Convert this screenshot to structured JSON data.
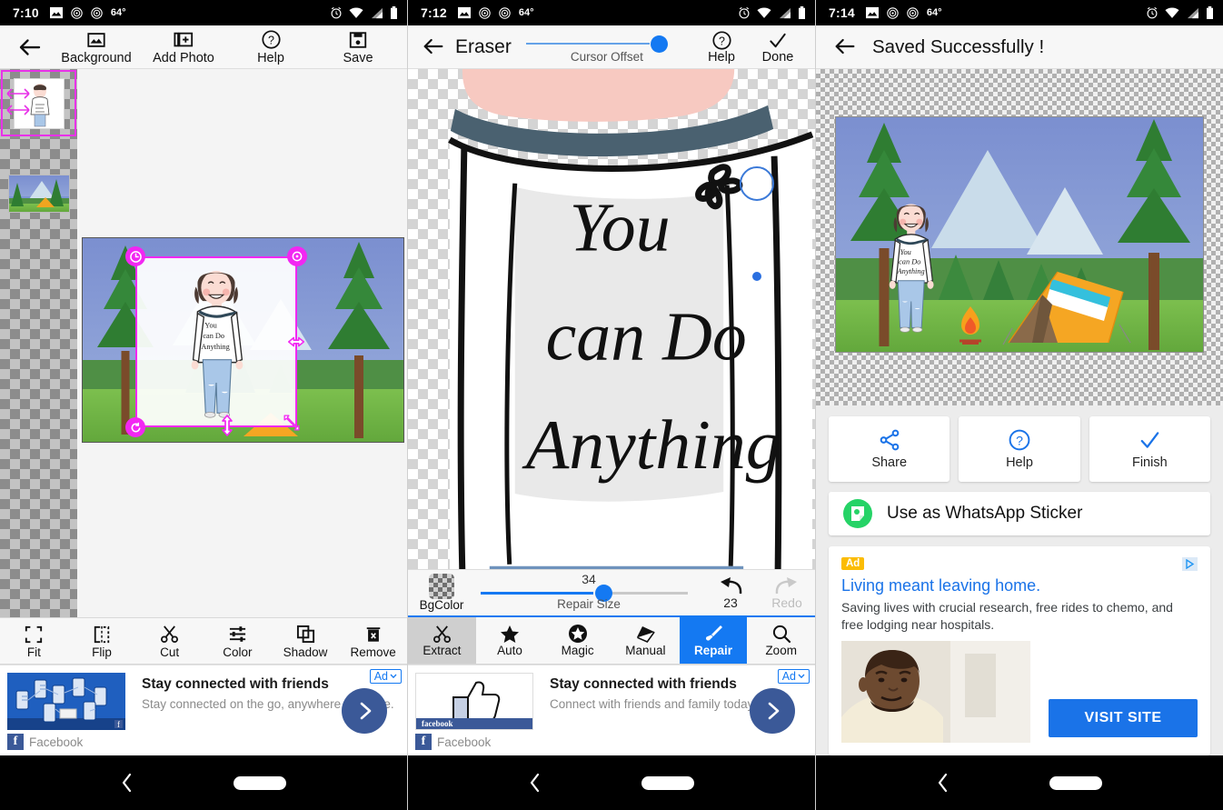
{
  "screens": [
    {
      "status_bar": {
        "time": "7:10",
        "temp": "64°",
        "icons": [
          "image-icon",
          "nfc-icon",
          "nfc-icon",
          "alarm-icon",
          "wifi-icon",
          "signal-icon",
          "battery-icon"
        ]
      },
      "app_bar": {
        "back_icon": "back-arrow-icon",
        "items": [
          {
            "label": "Background",
            "icon": "image-icon"
          },
          {
            "label": "Add Photo",
            "icon": "add-photo-icon"
          },
          {
            "label": "Help",
            "icon": "help-circle-icon"
          },
          {
            "label": "Save",
            "icon": "save-floppy-icon"
          }
        ]
      },
      "layers": [
        {
          "name": "girl-layer",
          "selected": true
        },
        {
          "name": "camping-background-layer",
          "selected": false
        }
      ],
      "canvas": {
        "shirt_text": [
          "You",
          "can Do",
          "Anything"
        ]
      },
      "tools": [
        {
          "label": "Fit",
          "icon": "fit-icon"
        },
        {
          "label": "Flip",
          "icon": "flip-icon"
        },
        {
          "label": "Cut",
          "icon": "scissors-icon"
        },
        {
          "label": "Color",
          "icon": "sliders-icon"
        },
        {
          "label": "Shadow",
          "icon": "shadow-squares-icon"
        },
        {
          "label": "Remove",
          "icon": "trash-icon"
        }
      ],
      "ad": {
        "badge": "Ad",
        "title": "Stay connected with friends",
        "subtitle": "Stay connected on the go, anywhere, anytime.",
        "source": "Facebook",
        "cta_icon": "chevron-right-icon"
      },
      "nav": {
        "back": "nav-back-icon",
        "home": "nav-home-pill"
      }
    },
    {
      "status_bar": {
        "time": "7:12",
        "temp": "64°"
      },
      "app_bar": {
        "title": "Eraser",
        "slider_label": "Cursor Offset",
        "help_label": "Help",
        "done_label": "Done"
      },
      "repair_bar": {
        "bgcolor_label": "BgColor",
        "slider_value": "34",
        "slider_label": "Repair Size",
        "undo_label": "23",
        "redo_label": "Redo"
      },
      "modes": [
        {
          "label": "Extract",
          "icon": "scissors-icon",
          "state": "grey"
        },
        {
          "label": "Auto",
          "icon": "star-icon",
          "state": "none"
        },
        {
          "label": "Magic",
          "icon": "star-circle-icon",
          "state": "none"
        },
        {
          "label": "Manual",
          "icon": "eraser-icon",
          "state": "none"
        },
        {
          "label": "Repair",
          "icon": "brush-icon",
          "state": "blue"
        },
        {
          "label": "Zoom",
          "icon": "magnifier-icon",
          "state": "none"
        }
      ],
      "canvas": {
        "shirt_text": [
          "You",
          "can Do",
          "Anything"
        ]
      },
      "ad": {
        "badge": "Ad",
        "title": "Stay connected with friends",
        "subtitle": "Connect with friends and family today",
        "source": "Facebook",
        "thumb_label": "facebook",
        "cta_icon": "chevron-right-icon"
      }
    },
    {
      "status_bar": {
        "time": "7:14",
        "temp": "64°"
      },
      "app_bar": {
        "title": "Saved Successfully !"
      },
      "actions": [
        {
          "label": "Share",
          "icon": "share-icon"
        },
        {
          "label": "Help",
          "icon": "help-circle-icon"
        },
        {
          "label": "Finish",
          "icon": "check-icon"
        }
      ],
      "whatsapp": {
        "label": "Use as WhatsApp Sticker",
        "icon": "whatsapp-sticker-icon"
      },
      "ad": {
        "badge": "Ad",
        "adchoices_icon": "adchoices-icon",
        "headline": "Living meant leaving home.",
        "description": "Saving lives with crucial research, free rides to chemo, and free lodging near hospitals.",
        "cta": "VISIT SITE"
      }
    }
  ],
  "colors": {
    "accent_blue": "#1479f2",
    "magenta_handle": "#f227f2",
    "facebook_blue": "#3b5998",
    "whatsapp_green": "#25d366",
    "ad_badge_yellow": "#fbbc04",
    "google_blue": "#1a73e8"
  }
}
